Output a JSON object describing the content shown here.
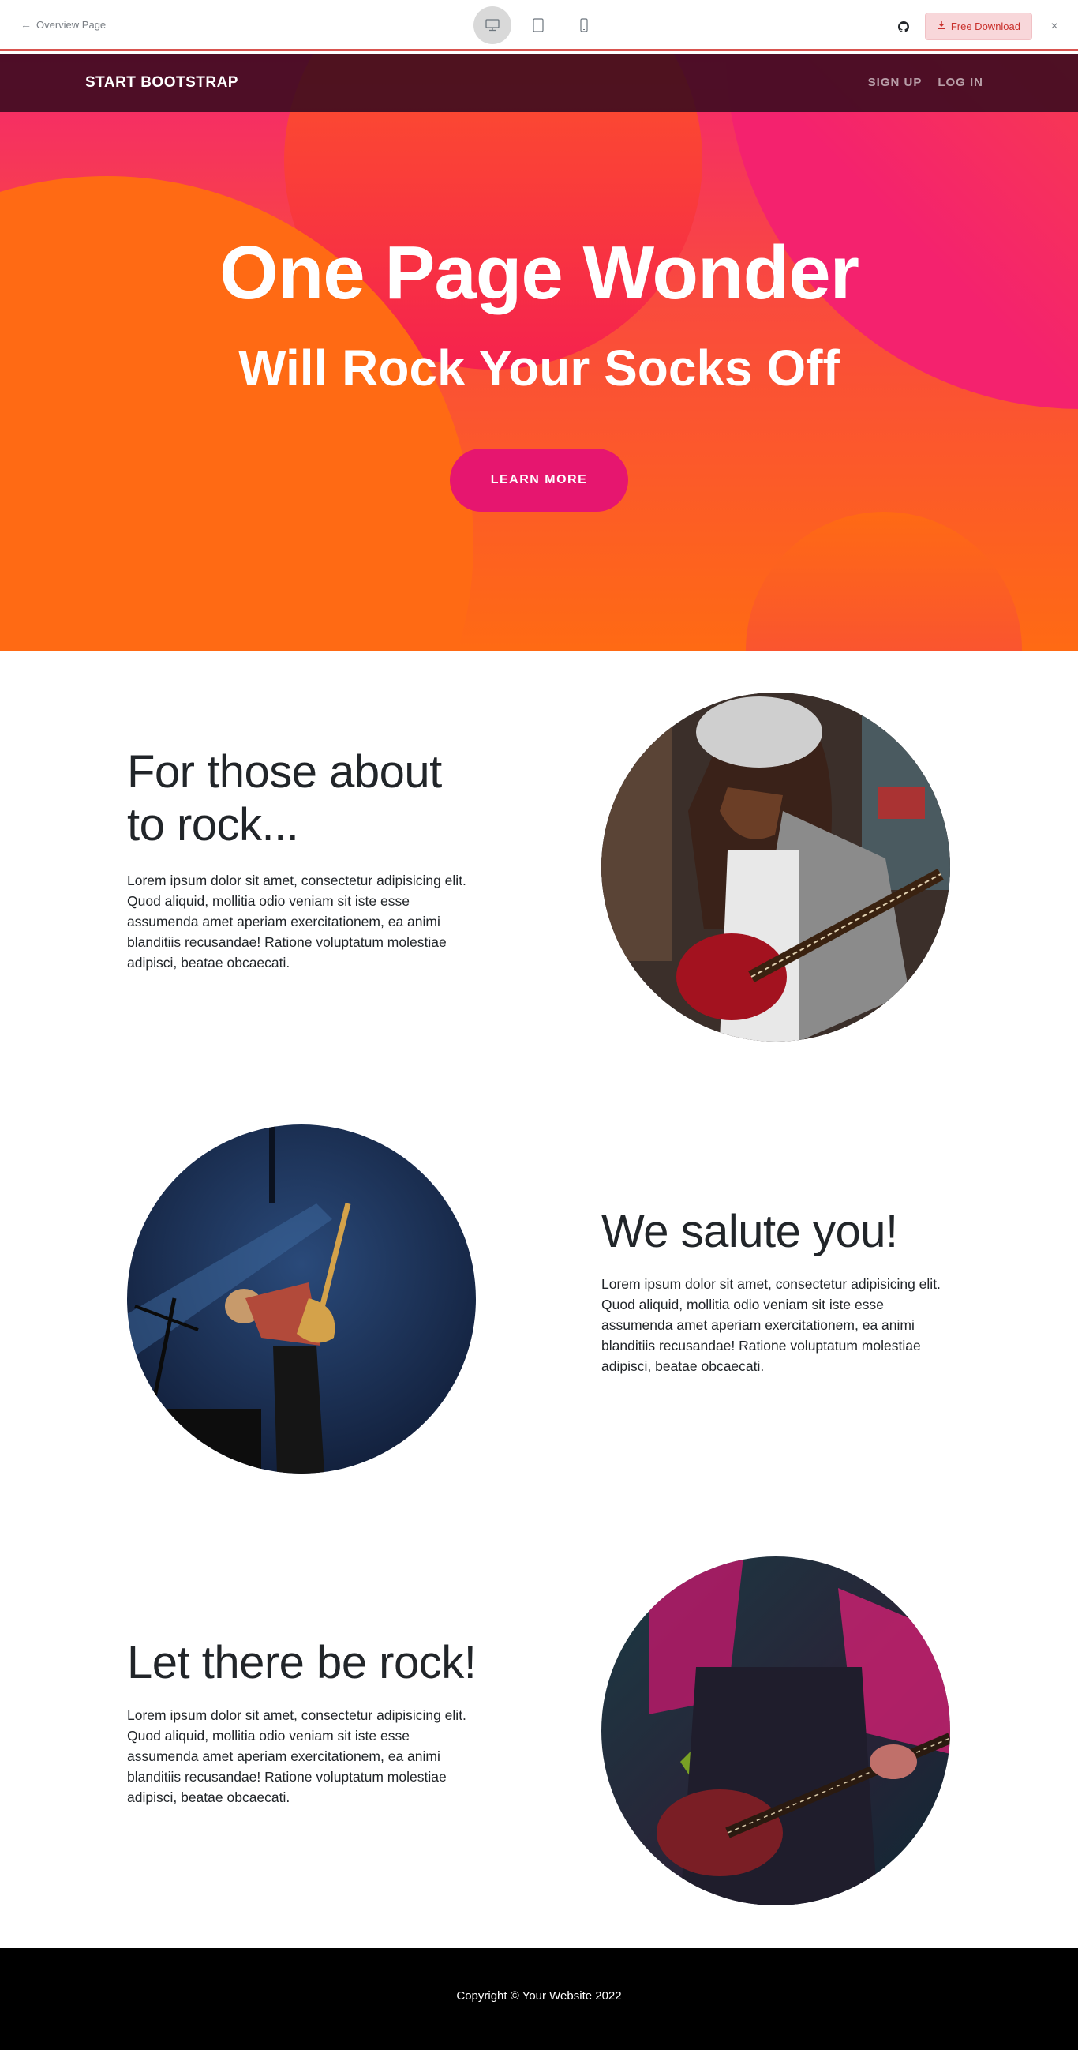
{
  "preview_bar": {
    "back_label": "Overview Page",
    "download_label": "Free Download",
    "close_label": "×"
  },
  "navbar": {
    "brand": "START BOOTSTRAP",
    "links": [
      "SIGN UP",
      "LOG IN"
    ]
  },
  "hero": {
    "title": "One Page Wonder",
    "subtitle": "Will Rock Your Socks Off",
    "button_label": "LEARN MORE"
  },
  "sections": [
    {
      "title": "For those about to rock...",
      "text": "Lorem ipsum dolor sit amet, consectetur adipisicing elit. Quod aliquid, mollitia odio veniam sit iste esse assumenda amet aperiam exercitationem, ea animi blanditiis recusandae! Ratione voluptatum molestiae adipisci, beatae obcaecati."
    },
    {
      "title": "We salute you!",
      "text": "Lorem ipsum dolor sit amet, consectetur adipisicing elit. Quod aliquid, mollitia odio veniam sit iste esse assumenda amet aperiam exercitationem, ea animi blanditiis recusandae! Ratione voluptatum molestiae adipisci, beatae obcaecati."
    },
    {
      "title": "Let there be rock!",
      "text": "Lorem ipsum dolor sit amet, consectetur adipisicing elit. Quod aliquid, mollitia odio veniam sit iste esse assumenda amet aperiam exercitationem, ea animi blanditiis recusandae! Ratione voluptatum molestiae adipisci, beatae obcaecati."
    }
  ],
  "footer": {
    "copyright": "Copyright © Your Website 2022"
  },
  "colors": {
    "accent": "#e6166f",
    "hero_orange": "#ff6a14",
    "hero_pink": "#f4266f",
    "navbar": "#370a1e",
    "footer": "#000000"
  }
}
